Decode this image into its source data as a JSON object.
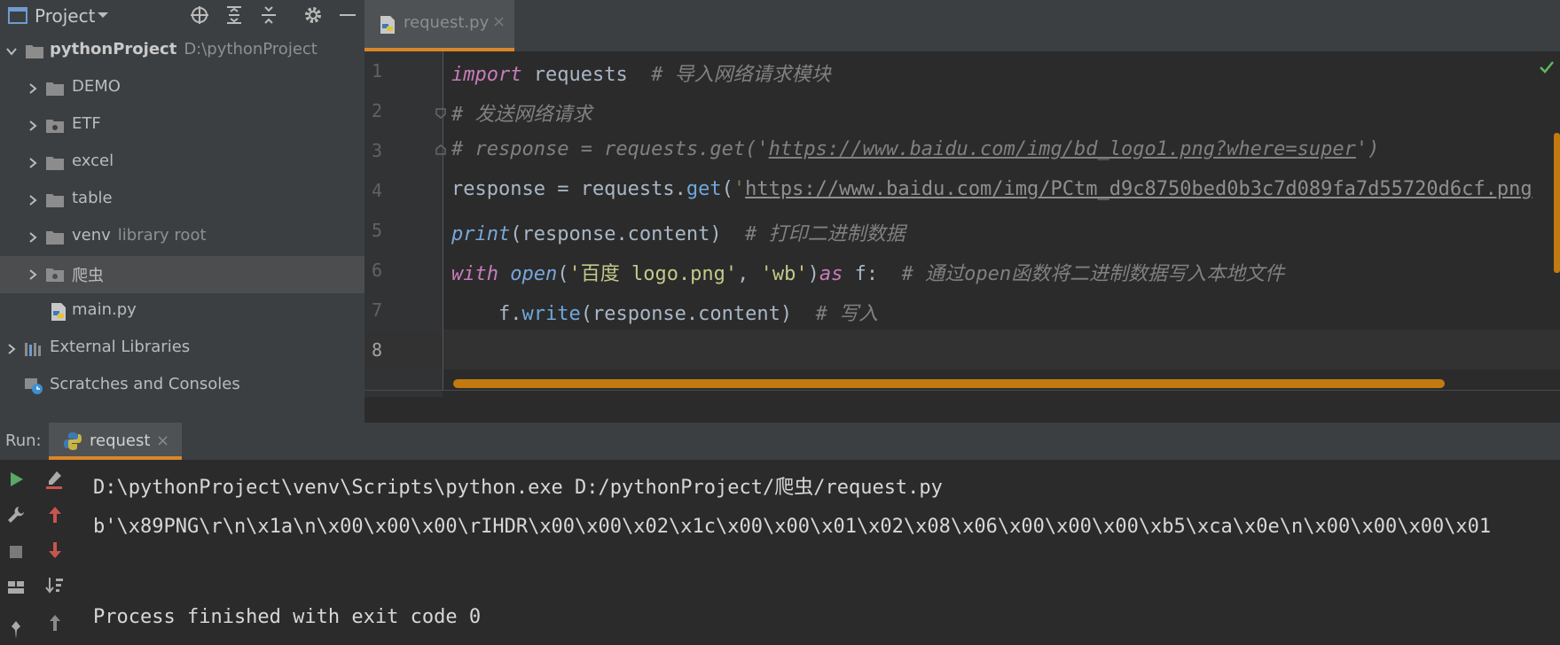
{
  "project_panel": {
    "title": "Project",
    "root": {
      "name": "pythonProject",
      "path": "D:\\pythonProject"
    },
    "items": [
      {
        "label": "DEMO"
      },
      {
        "label": "ETF"
      },
      {
        "label": "excel"
      },
      {
        "label": "table"
      },
      {
        "label": "venv",
        "sub": "library root"
      },
      {
        "label": "爬虫"
      },
      {
        "label": "main.py"
      }
    ],
    "external_libraries": "External Libraries",
    "scratches": "Scratches and Consoles"
  },
  "editor": {
    "tab": {
      "label": "request.py",
      "close": "×"
    },
    "line_numbers": [
      "1",
      "2",
      "3",
      "4",
      "5",
      "6",
      "7",
      "8"
    ],
    "code": {
      "l1_kw": "import",
      "l1_mod": " requests  ",
      "l1_comment": "# 导入网络请求模块",
      "l2_comment": "# 发送网络请求",
      "l3_prefix": "# response = requests.get('",
      "l3_url": "https://www.baidu.com/img/bd_logo1.png?where=super",
      "l3_suffix": "')",
      "l4_prefix": "response = requests.",
      "l4_func": "get",
      "l4_paren": "(",
      "l4_quote": "'",
      "l4_url": "https://www.baidu.com/img/PCtm_d9c8750bed0b3c7d089fa7d55720d6cf.png",
      "l5_print": "print",
      "l5_args": "(response.content)  ",
      "l5_comment": "# 打印二进制数据",
      "l6_with": "with",
      "l6_sp": " ",
      "l6_open": "open",
      "l6_p1": "(",
      "l6_s1": "'百度 logo.png'",
      "l6_comma": ", ",
      "l6_s2": "'wb'",
      "l6_p2": ")",
      "l6_as": "as",
      "l6_f": " f:  ",
      "l6_comment": "# 通过open函数将二进制数据写入本地文件",
      "l7_indent": "    f.",
      "l7_write": "write",
      "l7_args": "(response.content)  ",
      "l7_comment": "# 写入"
    }
  },
  "run_panel": {
    "label": "Run:",
    "tab": {
      "label": "request",
      "close": "×"
    },
    "output": [
      "D:\\pythonProject\\venv\\Scripts\\python.exe D:/pythonProject/爬虫/request.py",
      "b'\\x89PNG\\r\\n\\x1a\\n\\x00\\x00\\x00\\rIHDR\\x00\\x00\\x02\\x1c\\x00\\x00\\x01\\x02\\x08\\x06\\x00\\x00\\x00\\xb5\\xca\\x0e\\n\\x00\\x00\\x00\\x01",
      "",
      "Process finished with exit code 0"
    ]
  },
  "colors": {
    "accent_orange": "#d9862b",
    "keyword_purple": "#c77dbb",
    "comment_gray": "#808080",
    "string_green": "#6a8759",
    "url_blue": "#287bde"
  }
}
